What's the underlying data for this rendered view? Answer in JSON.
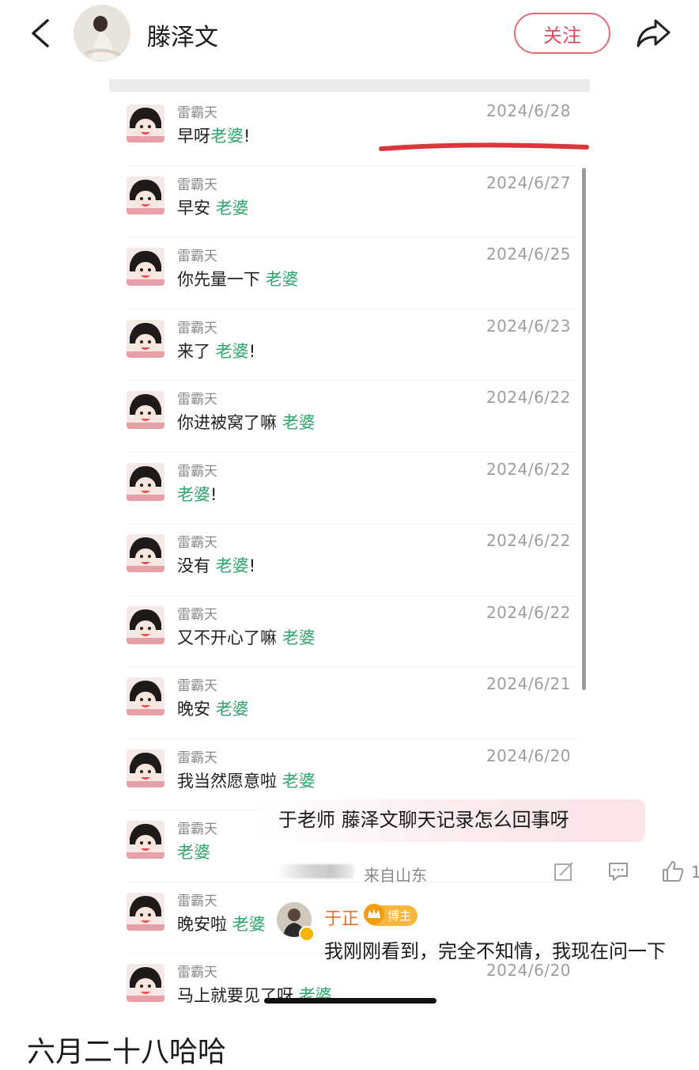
{
  "header": {
    "profile_name": "滕泽文",
    "follow_label": "关注"
  },
  "messages": [
    {
      "sender": "雷霸天",
      "date": "2024/6/28",
      "text_before": "早呀",
      "keyword": "老婆",
      "text_after": "!"
    },
    {
      "sender": "雷霸天",
      "date": "2024/6/27",
      "text_before": "早安 ",
      "keyword": "老婆",
      "text_after": ""
    },
    {
      "sender": "雷霸天",
      "date": "2024/6/25",
      "text_before": "你先量一下 ",
      "keyword": "老婆",
      "text_after": ""
    },
    {
      "sender": "雷霸天",
      "date": "2024/6/23",
      "text_before": "来了 ",
      "keyword": "老婆",
      "text_after": "!"
    },
    {
      "sender": "雷霸天",
      "date": "2024/6/22",
      "text_before": "你进被窝了嘛 ",
      "keyword": "老婆",
      "text_after": ""
    },
    {
      "sender": "雷霸天",
      "date": "2024/6/22",
      "text_before": "",
      "keyword": "老婆",
      "text_after": "!"
    },
    {
      "sender": "雷霸天",
      "date": "2024/6/22",
      "text_before": "没有 ",
      "keyword": "老婆",
      "text_after": "!"
    },
    {
      "sender": "雷霸天",
      "date": "2024/6/22",
      "text_before": "又不开心了嘛 ",
      "keyword": "老婆",
      "text_after": ""
    },
    {
      "sender": "雷霸天",
      "date": "2024/6/21",
      "text_before": "晚安 ",
      "keyword": "老婆",
      "text_after": ""
    },
    {
      "sender": "雷霸天",
      "date": "2024/6/20",
      "text_before": "我当然愿意啦 ",
      "keyword": "老婆",
      "text_after": ""
    },
    {
      "sender": "雷霸天",
      "date": "",
      "text_before": "",
      "keyword": "老婆",
      "text_after": ""
    },
    {
      "sender": "雷霸天",
      "date": "",
      "text_before": "晚安啦 ",
      "keyword": "老婆",
      "text_after": ""
    },
    {
      "sender": "雷霸天",
      "date": "2024/6/20",
      "text_before": "马上就要见了呀 ",
      "keyword": "老婆",
      "text_after": ""
    }
  ],
  "comment": {
    "text": "于老师 藤泽文聊天记录怎么回事呀",
    "location": "来自山东",
    "like_count": "1"
  },
  "reply": {
    "name": "于正",
    "badge": "博主",
    "text": "我刚刚看到，完全不知情，我现在问一下"
  },
  "caption": "六月二十八哈哈",
  "colors": {
    "keyword": "#2ea66b",
    "follow": "#e04a5c",
    "annotation": "#d9363e",
    "reply_name": "#e8702a",
    "badge": "#f6b73c"
  }
}
